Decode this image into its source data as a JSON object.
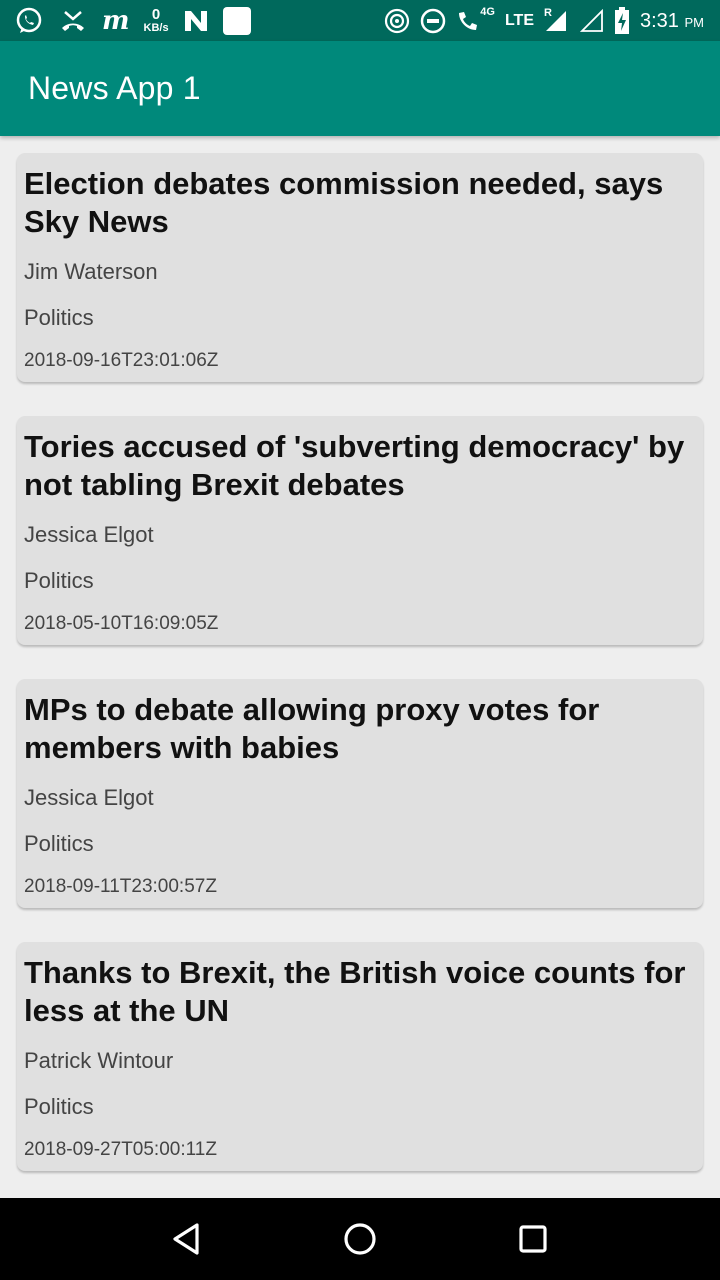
{
  "status_bar": {
    "speed_value": "0",
    "speed_unit": "KB/s",
    "network": "4G",
    "lte": "LTE",
    "roaming": "R",
    "time": "3:31",
    "ampm": "PM"
  },
  "app_bar": {
    "title": "News App 1"
  },
  "articles": [
    {
      "title": "Election debates commission needed, says Sky News",
      "author": "Jim Waterson",
      "section": "Politics",
      "date": "2018-09-16T23:01:06Z"
    },
    {
      "title": "Tories accused of 'subverting democracy' by not tabling Brexit debates",
      "author": "Jessica Elgot",
      "section": "Politics",
      "date": "2018-05-10T16:09:05Z"
    },
    {
      "title": "MPs to debate allowing proxy votes for members with babies",
      "author": "Jessica Elgot",
      "section": "Politics",
      "date": "2018-09-11T23:00:57Z"
    },
    {
      "title": "Thanks to Brexit, the British voice counts for less at the UN",
      "author": "Patrick Wintour",
      "section": "Politics",
      "date": "2018-09-27T05:00:11Z"
    }
  ],
  "icons": {
    "status_left": [
      "whatsapp-icon",
      "missed-call-icon",
      "m-app-icon",
      "network-speed-icon",
      "n-app-icon",
      "white-square-icon"
    ],
    "status_right": [
      "hotspot-icon",
      "do-not-disturb-icon",
      "wifi-calling-icon",
      "signal-icon",
      "signal-empty-icon",
      "battery-charging-icon"
    ],
    "nav": [
      "back-icon",
      "home-icon",
      "recents-icon"
    ]
  },
  "colors": {
    "status_bar": "#00695c",
    "app_bar": "#00897b",
    "card_background": "#e0e0e0",
    "page_background": "#eeeeee"
  }
}
